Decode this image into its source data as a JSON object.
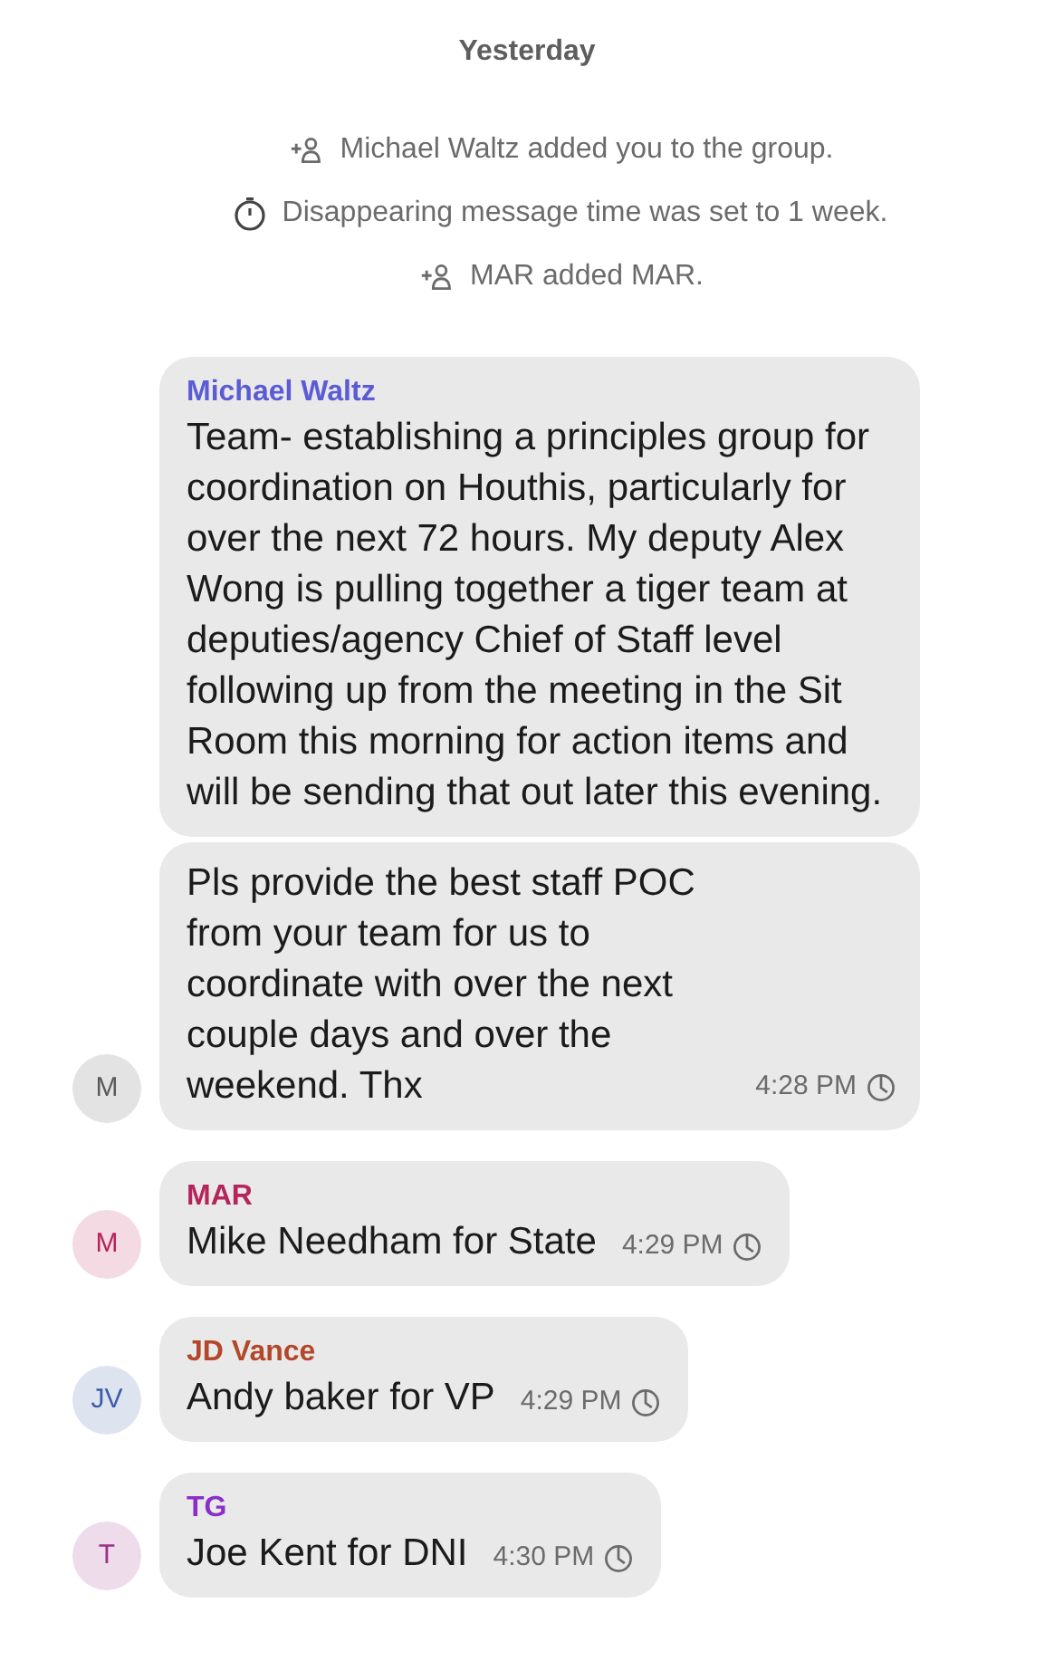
{
  "date_header": "Yesterday",
  "events": [
    {
      "kind": "member",
      "text": "Michael Waltz added you to the group."
    },
    {
      "kind": "timer",
      "text": "Disappearing message time was set to 1 week."
    },
    {
      "kind": "member",
      "text": "MAR added MAR."
    }
  ],
  "messages": [
    {
      "sender": "Michael Waltz",
      "color": "#5b5bd6",
      "avatar": {
        "initials": "M",
        "color": "#5a5a5a"
      },
      "bubbles": [
        {
          "text": "Team- establishing a principles group for coordination on Houthis, particularly for over the next 72 hours. My deputy Alex Wong is pulling together a tiger team at deputies/agency Chief of Staff level following up from the meeting in the Sit Room this morning for action items and will be sending that out later this evening."
        },
        {
          "text": "Pls provide the best staff POC from your team for us to coordinate with over the next couple days and over the weekend. Thx",
          "time": "4:28 PM"
        }
      ]
    },
    {
      "sender": "MAR",
      "color": "#b5245a",
      "avatar": {
        "initials": "M",
        "color": "#b5245a"
      },
      "bubbles": [
        {
          "text": "Mike Needham for State",
          "time": "4:29 PM"
        }
      ]
    },
    {
      "sender": "JD Vance",
      "color": "#b2472a",
      "avatar": {
        "initials": "JV",
        "color": "#3a5ba8"
      },
      "bubbles": [
        {
          "text": "Andy baker for VP",
          "time": "4:29 PM"
        }
      ]
    },
    {
      "sender": "TG",
      "color": "#8b2fc9",
      "avatar": {
        "initials": "T",
        "color": "#9b2f8a"
      },
      "bubbles": [
        {
          "text": "Joe Kent for DNI",
          "time": "4:30 PM"
        }
      ]
    }
  ]
}
